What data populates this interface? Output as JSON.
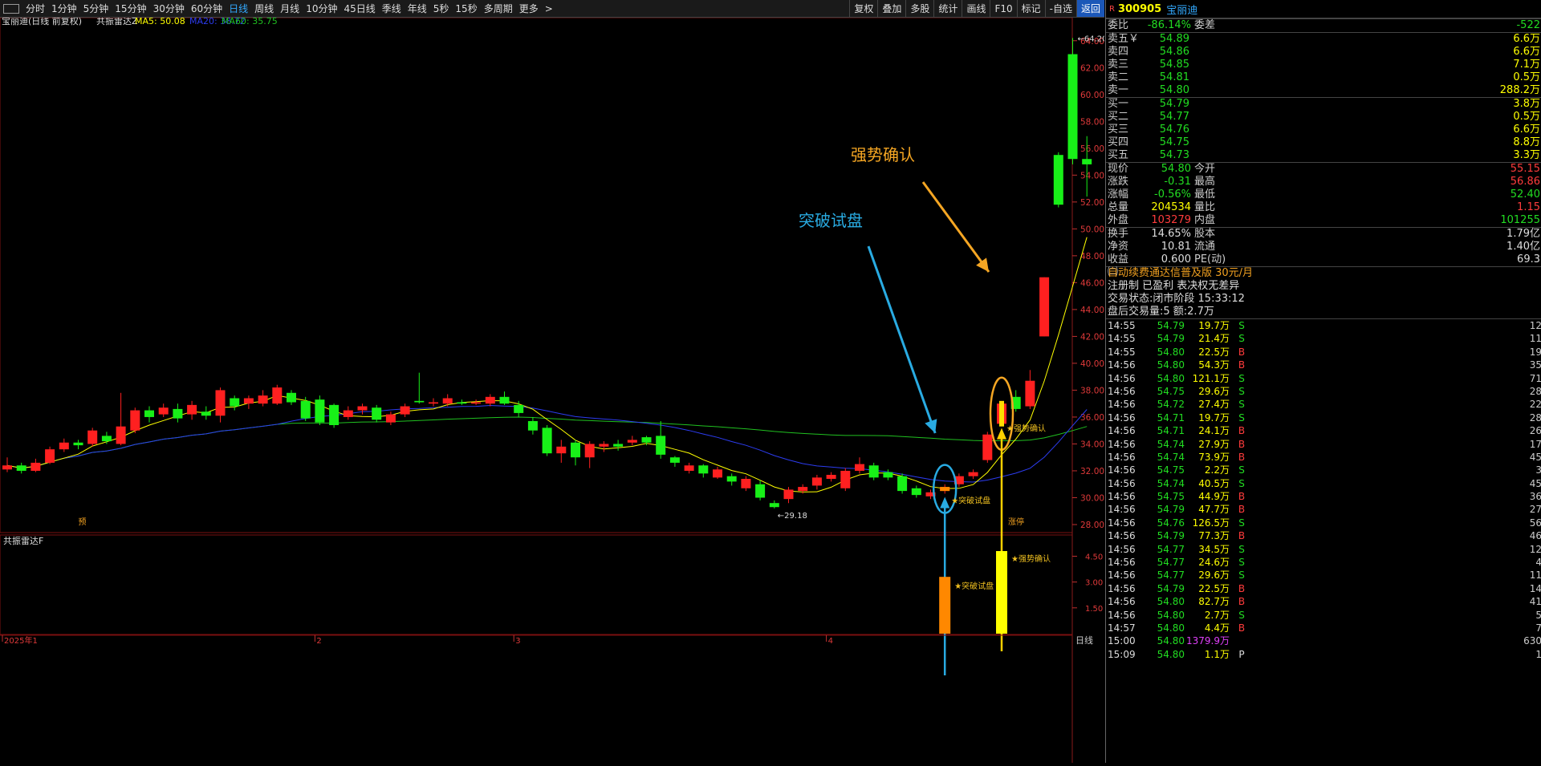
{
  "toolbar": {
    "periods": [
      "分时",
      "1分钟",
      "5分钟",
      "15分钟",
      "30分钟",
      "60分钟",
      "日线",
      "周线",
      "月线",
      "10分钟",
      "45日线",
      "季线",
      "年线",
      "5秒",
      "15秒",
      "多周期",
      "更多"
    ],
    "active_period": "日线",
    "more_arrow": ">",
    "actions": [
      "复权",
      "叠加",
      "多股",
      "统计",
      "画线",
      "F10",
      "标记",
      "-自选",
      "返回"
    ]
  },
  "chart": {
    "title": "宝丽迪(日线 前复权)",
    "indicator_name": "共振雷达Z",
    "ma5": "MA5: 50.08",
    "ma20": "MA20: 38.72",
    "ma60": "MA60: 35.75",
    "price_ticks": [
      "64.00",
      "62.00",
      "60.00",
      "58.00",
      "56.00",
      "54.00",
      "52.00",
      "50.00",
      "48.00",
      "46.00",
      "44.00",
      "42.00",
      "40.00",
      "38.00",
      "36.00",
      "34.00",
      "32.00",
      "30.00",
      "28.00"
    ],
    "high_label": "64.20",
    "low_label": "29.18",
    "annotation_strong": "强势确认",
    "annotation_breakout": "突破试盘",
    "marker_strong": "★强势确认",
    "marker_breakout": "★突破试盘",
    "pre_label": "预",
    "limit_label": "涨停",
    "sub_title": "共振雷达F",
    "sub_ticks": [
      "4.50",
      "3.00",
      "1.50"
    ],
    "sub_marker_breakout": "★突破试盘",
    "sub_marker_strong": "★强势确认",
    "date_labels": [
      "2025年1",
      "2",
      "3",
      "4"
    ],
    "period_label": "日线",
    "colors": {
      "up": "#ff2020",
      "down": "#18f018",
      "ma5": "#ffff00",
      "ma20": "#2c3cf0",
      "ma60": "#20c020",
      "annot_orange": "#f5a623",
      "annot_blue": "#29abe2"
    }
  },
  "chart_data": {
    "type": "candlestick",
    "ylim": [
      28,
      65
    ],
    "candles": [
      {
        "o": 32.1,
        "c": 32.4,
        "h": 33.0,
        "l": 31.9
      },
      {
        "o": 32.4,
        "c": 32.0,
        "h": 32.6,
        "l": 31.8
      },
      {
        "o": 32.0,
        "c": 32.6,
        "h": 32.9,
        "l": 31.9
      },
      {
        "o": 32.6,
        "c": 33.6,
        "h": 33.8,
        "l": 32.5
      },
      {
        "o": 33.6,
        "c": 34.1,
        "h": 34.4,
        "l": 33.4
      },
      {
        "o": 34.1,
        "c": 33.9,
        "h": 34.3,
        "l": 33.6
      },
      {
        "o": 34.0,
        "c": 35.0,
        "h": 35.2,
        "l": 33.8
      },
      {
        "o": 34.6,
        "c": 34.2,
        "h": 34.9,
        "l": 34.0
      },
      {
        "o": 34.0,
        "c": 35.3,
        "h": 37.8,
        "l": 33.9
      },
      {
        "o": 35.0,
        "c": 36.5,
        "h": 36.7,
        "l": 34.8
      },
      {
        "o": 36.5,
        "c": 36.0,
        "h": 36.8,
        "l": 35.6
      },
      {
        "o": 36.2,
        "c": 36.7,
        "h": 37.0,
        "l": 36.0
      },
      {
        "o": 36.6,
        "c": 35.9,
        "h": 37.0,
        "l": 35.6
      },
      {
        "o": 36.2,
        "c": 36.9,
        "h": 37.2,
        "l": 35.8
      },
      {
        "o": 36.4,
        "c": 36.1,
        "h": 36.8,
        "l": 35.8
      },
      {
        "o": 36.1,
        "c": 38.0,
        "h": 38.2,
        "l": 35.6
      },
      {
        "o": 37.4,
        "c": 36.8,
        "h": 37.6,
        "l": 36.5
      },
      {
        "o": 37.0,
        "c": 37.4,
        "h": 37.6,
        "l": 36.6
      },
      {
        "o": 37.0,
        "c": 37.6,
        "h": 38.0,
        "l": 36.8
      },
      {
        "o": 37.0,
        "c": 38.2,
        "h": 38.4,
        "l": 36.9
      },
      {
        "o": 37.8,
        "c": 37.1,
        "h": 38.0,
        "l": 36.9
      },
      {
        "o": 37.2,
        "c": 35.9,
        "h": 37.5,
        "l": 35.7
      },
      {
        "o": 37.3,
        "c": 35.6,
        "h": 37.6,
        "l": 35.4
      },
      {
        "o": 36.9,
        "c": 35.4,
        "h": 37.0,
        "l": 35.2
      },
      {
        "o": 36.0,
        "c": 36.5,
        "h": 36.8,
        "l": 35.8
      },
      {
        "o": 36.5,
        "c": 36.8,
        "h": 37.0,
        "l": 36.2
      },
      {
        "o": 36.7,
        "c": 35.8,
        "h": 36.9,
        "l": 35.6
      },
      {
        "o": 35.6,
        "c": 36.2,
        "h": 36.4,
        "l": 35.4
      },
      {
        "o": 36.2,
        "c": 36.8,
        "h": 37.0,
        "l": 36.0
      },
      {
        "o": 37.2,
        "c": 37.1,
        "h": 39.3,
        "l": 37.0
      },
      {
        "o": 37.0,
        "c": 37.1,
        "h": 37.4,
        "l": 36.8
      },
      {
        "o": 37.0,
        "c": 37.4,
        "h": 37.7,
        "l": 36.8
      },
      {
        "o": 37.1,
        "c": 37.0,
        "h": 37.3,
        "l": 36.9
      },
      {
        "o": 37.0,
        "c": 37.1,
        "h": 37.3,
        "l": 36.9
      },
      {
        "o": 37.0,
        "c": 37.5,
        "h": 37.7,
        "l": 36.8
      },
      {
        "o": 37.5,
        "c": 37.0,
        "h": 37.9,
        "l": 36.9
      },
      {
        "o": 36.9,
        "c": 36.3,
        "h": 37.2,
        "l": 36.0
      },
      {
        "o": 35.7,
        "c": 35.0,
        "h": 36.0,
        "l": 34.7
      },
      {
        "o": 35.2,
        "c": 33.3,
        "h": 35.4,
        "l": 33.1
      },
      {
        "o": 33.3,
        "c": 33.8,
        "h": 34.3,
        "l": 32.6
      },
      {
        "o": 34.1,
        "c": 33.0,
        "h": 34.3,
        "l": 32.4
      },
      {
        "o": 33.0,
        "c": 34.0,
        "h": 34.2,
        "l": 32.2
      },
      {
        "o": 33.8,
        "c": 34.0,
        "h": 34.2,
        "l": 33.4
      },
      {
        "o": 34.0,
        "c": 33.8,
        "h": 34.3,
        "l": 33.5
      },
      {
        "o": 34.1,
        "c": 34.3,
        "h": 34.6,
        "l": 33.9
      },
      {
        "o": 34.5,
        "c": 34.1,
        "h": 34.6,
        "l": 33.9
      },
      {
        "o": 34.6,
        "c": 33.2,
        "h": 35.7,
        "l": 32.9
      },
      {
        "o": 33.0,
        "c": 32.6,
        "h": 33.1,
        "l": 32.3
      },
      {
        "o": 32.0,
        "c": 32.4,
        "h": 32.6,
        "l": 31.8
      },
      {
        "o": 32.4,
        "c": 31.8,
        "h": 32.5,
        "l": 31.5
      },
      {
        "o": 31.5,
        "c": 32.1,
        "h": 32.3,
        "l": 31.4
      },
      {
        "o": 31.6,
        "c": 31.2,
        "h": 31.8,
        "l": 30.9
      },
      {
        "o": 30.7,
        "c": 31.4,
        "h": 31.6,
        "l": 30.5
      },
      {
        "o": 31.0,
        "c": 30.0,
        "h": 31.3,
        "l": 29.8
      },
      {
        "o": 29.6,
        "c": 29.3,
        "h": 29.8,
        "l": 29.2
      },
      {
        "o": 29.9,
        "c": 30.6,
        "h": 30.8,
        "l": 29.6
      },
      {
        "o": 30.5,
        "c": 30.8,
        "h": 31.0,
        "l": 30.3
      },
      {
        "o": 30.9,
        "c": 31.5,
        "h": 31.7,
        "l": 30.6
      },
      {
        "o": 31.4,
        "c": 31.7,
        "h": 31.9,
        "l": 31.2
      },
      {
        "o": 30.7,
        "c": 32.0,
        "h": 32.2,
        "l": 30.5
      },
      {
        "o": 32.0,
        "c": 32.5,
        "h": 33.0,
        "l": 31.8
      },
      {
        "o": 32.4,
        "c": 31.5,
        "h": 32.6,
        "l": 31.3
      },
      {
        "o": 31.9,
        "c": 31.5,
        "h": 32.1,
        "l": 31.3
      },
      {
        "o": 31.6,
        "c": 30.5,
        "h": 31.8,
        "l": 30.3
      },
      {
        "o": 30.7,
        "c": 30.2,
        "h": 30.9,
        "l": 30.0
      },
      {
        "o": 30.1,
        "c": 30.4,
        "h": 30.6,
        "l": 29.9
      },
      {
        "o": 30.5,
        "c": 30.8,
        "h": 31.0,
        "l": 30.3
      },
      {
        "o": 31.0,
        "c": 31.6,
        "h": 31.8,
        "l": 30.8
      },
      {
        "o": 31.6,
        "c": 31.9,
        "h": 32.1,
        "l": 31.4
      },
      {
        "o": 32.8,
        "c": 34.7,
        "h": 34.9,
        "l": 32.6
      },
      {
        "o": 35.5,
        "c": 37.0,
        "h": 37.2,
        "l": 35.3
      },
      {
        "o": 37.5,
        "c": 36.6,
        "h": 38.0,
        "l": 36.4
      },
      {
        "o": 36.8,
        "c": 38.7,
        "h": 39.5,
        "l": 36.6
      },
      {
        "o": 42.0,
        "c": 46.4,
        "h": 46.4,
        "l": 42.0
      },
      {
        "o": 55.5,
        "c": 51.8,
        "h": 55.7,
        "l": 51.6
      },
      {
        "o": 63.0,
        "c": 55.2,
        "h": 64.2,
        "l": 54.8
      },
      {
        "o": 55.2,
        "c": 54.8,
        "h": 56.9,
        "l": 52.4
      }
    ],
    "sub_bars": [
      {
        "i": 66,
        "value": 3.3,
        "color": "#ff8800"
      },
      {
        "i": 70,
        "value": 4.8,
        "color": "#ffff00"
      }
    ],
    "sub_ylim": [
      0,
      5.5
    ]
  },
  "quote": {
    "r_badge": "R",
    "code": "300905",
    "name": "宝丽迪",
    "weibi_label": "委比",
    "weibi": "-86.14%",
    "weicha_label": "委差",
    "weicha": "-522",
    "asks": [
      {
        "label": "卖五￥",
        "price": "54.89",
        "vol": "6.6万"
      },
      {
        "label": "卖四",
        "price": "54.86",
        "vol": "6.6万"
      },
      {
        "label": "卖三",
        "price": "54.85",
        "vol": "7.1万"
      },
      {
        "label": "卖二",
        "price": "54.81",
        "vol": "0.5万"
      },
      {
        "label": "卖一",
        "price": "54.80",
        "vol": "288.2万"
      }
    ],
    "bids": [
      {
        "label": "买一",
        "price": "54.79",
        "vol": "3.8万"
      },
      {
        "label": "买二",
        "price": "54.77",
        "vol": "0.5万"
      },
      {
        "label": "买三",
        "price": "54.76",
        "vol": "6.6万"
      },
      {
        "label": "买四",
        "price": "54.75",
        "vol": "8.8万"
      },
      {
        "label": "买五",
        "price": "54.73",
        "vol": "3.3万"
      }
    ],
    "stats": [
      {
        "l1": "现价",
        "v1": "54.80",
        "c1": "green",
        "l2": "今开",
        "v2": "55.15",
        "c2": "red"
      },
      {
        "l1": "涨跌",
        "v1": "-0.31",
        "c1": "green",
        "l2": "最高",
        "v2": "56.86",
        "c2": "red"
      },
      {
        "l1": "涨幅",
        "v1": "-0.56%",
        "c1": "green",
        "l2": "最低",
        "v2": "52.40",
        "c2": "green"
      },
      {
        "l1": "总量",
        "v1": "204534",
        "c1": "yellow",
        "l2": "量比",
        "v2": "1.15",
        "c2": "red"
      },
      {
        "l1": "外盘",
        "v1": "103279",
        "c1": "red",
        "l2": "内盘",
        "v2": "101255",
        "c2": "green"
      }
    ],
    "stats2": [
      {
        "l1": "换手",
        "v1": "14.65%",
        "l2": "股本",
        "v2": "1.79亿"
      },
      {
        "l1": "净资",
        "v1": "10.81",
        "l2": "流通",
        "v2": "1.40亿"
      },
      {
        "l1": "收益㈢",
        "v1": "0.600",
        "l2": "PE(动)",
        "v2": "69.3"
      }
    ],
    "ad_text": "自动续费通达信普及版  30元/月",
    "ad_text2": "注册制 已盈利 表决权无差异",
    "trade_status_label": "交易状态:",
    "trade_status": "闭市阶段 15:33:12",
    "after_hours": "盘后交易量:5  额:2.7万"
  },
  "ticks": [
    {
      "t": "14:55",
      "p": "54.79",
      "v": "19.7万",
      "bs": "S",
      "n": "12"
    },
    {
      "t": "14:55",
      "p": "54.79",
      "v": "21.4万",
      "bs": "S",
      "n": "11"
    },
    {
      "t": "14:55",
      "p": "54.80",
      "v": "22.5万",
      "bs": "B",
      "n": "19"
    },
    {
      "t": "14:56",
      "p": "54.80",
      "v": "54.3万",
      "bs": "B",
      "n": "35"
    },
    {
      "t": "14:56",
      "p": "54.80",
      "v": "121.1万",
      "bs": "S",
      "n": "71"
    },
    {
      "t": "14:56",
      "p": "54.75",
      "v": "29.6万",
      "bs": "S",
      "n": "28"
    },
    {
      "t": "14:56",
      "p": "54.72",
      "v": "27.4万",
      "bs": "S",
      "n": "22"
    },
    {
      "t": "14:56",
      "p": "54.71",
      "v": "19.7万",
      "bs": "S",
      "n": "28"
    },
    {
      "t": "14:56",
      "p": "54.71",
      "v": "24.1万",
      "bs": "B",
      "n": "26"
    },
    {
      "t": "14:56",
      "p": "54.74",
      "v": "27.9万",
      "bs": "B",
      "n": "17"
    },
    {
      "t": "14:56",
      "p": "54.74",
      "v": "73.9万",
      "bs": "B",
      "n": "45"
    },
    {
      "t": "14:56",
      "p": "54.75",
      "v": "2.2万",
      "bs": "S",
      "n": "3"
    },
    {
      "t": "14:56",
      "p": "54.74",
      "v": "40.5万",
      "bs": "S",
      "n": "45"
    },
    {
      "t": "14:56",
      "p": "54.75",
      "v": "44.9万",
      "bs": "B",
      "n": "36"
    },
    {
      "t": "14:56",
      "p": "54.79",
      "v": "47.7万",
      "bs": "B",
      "n": "27"
    },
    {
      "t": "14:56",
      "p": "54.76",
      "v": "126.5万",
      "bs": "S",
      "n": "56"
    },
    {
      "t": "14:56",
      "p": "54.79",
      "v": "77.3万",
      "bs": "B",
      "n": "46"
    },
    {
      "t": "14:56",
      "p": "54.77",
      "v": "34.5万",
      "bs": "S",
      "n": "12"
    },
    {
      "t": "14:56",
      "p": "54.77",
      "v": "24.6万",
      "bs": "S",
      "n": "4"
    },
    {
      "t": "14:56",
      "p": "54.77",
      "v": "29.6万",
      "bs": "S",
      "n": "11"
    },
    {
      "t": "14:56",
      "p": "54.79",
      "v": "22.5万",
      "bs": "B",
      "n": "14"
    },
    {
      "t": "14:56",
      "p": "54.80",
      "v": "82.7万",
      "bs": "B",
      "n": "41"
    },
    {
      "t": "14:56",
      "p": "54.80",
      "v": "2.7万",
      "bs": "S",
      "n": "5"
    },
    {
      "t": "14:57",
      "p": "54.80",
      "v": "4.4万",
      "bs": "B",
      "n": "7"
    },
    {
      "t": "15:00",
      "p": "54.80",
      "v": "1379.9万",
      "bs": "",
      "n": "630"
    },
    {
      "t": "15:09",
      "p": "54.80",
      "v": "1.1万",
      "bs": "P",
      "n": "1"
    }
  ]
}
